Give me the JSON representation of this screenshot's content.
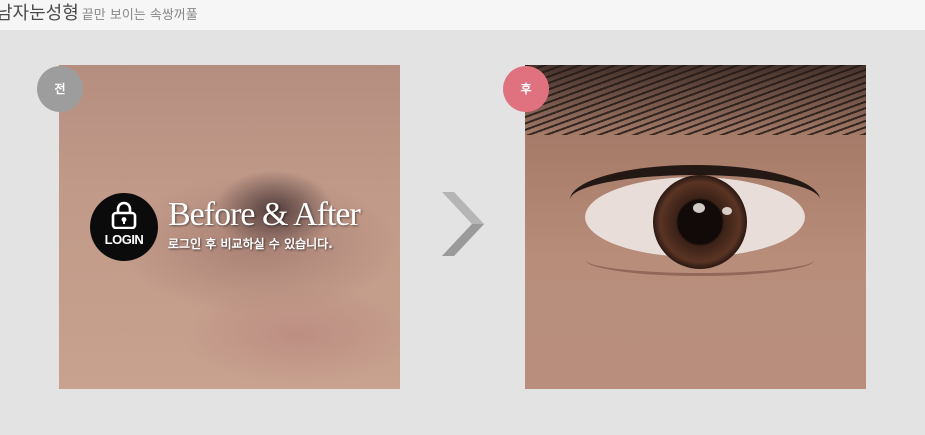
{
  "header": {
    "title": "남자눈성형",
    "subtitle": "끝만 보이는 속쌍꺼풀"
  },
  "badges": {
    "before": "전",
    "after": "후"
  },
  "overlay": {
    "login_label": "LOGIN",
    "title": "Before & After",
    "message": "로그인 후 비교하실 수 있습니다."
  },
  "icons": {
    "lock": "lock-icon",
    "arrow": "chevron-right-icon"
  },
  "colors": {
    "badge_before": "#9d9d9d",
    "badge_after": "#e0727f",
    "background": "#e3e3e3"
  }
}
